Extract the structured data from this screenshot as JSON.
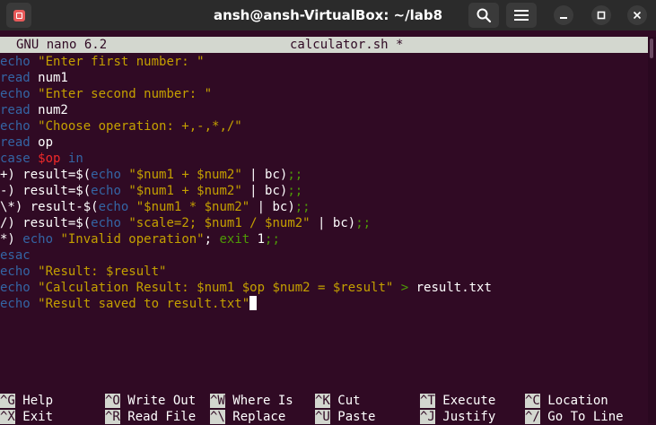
{
  "window": {
    "title": "ansh@ansh-VirtualBox: ~/lab8",
    "new_tab_icon": "new-tab-icon",
    "search_icon": "search-icon",
    "menu_icon": "hamburger-menu-icon",
    "minimize_icon": "minimize-icon",
    "maximize_icon": "maximize-icon",
    "close_icon": "close-icon"
  },
  "nano": {
    "version": "GNU nano 6.2",
    "filename": "calculator.sh *"
  },
  "colors": {
    "background": "#300a24",
    "keyword": "#3465a4",
    "string": "#c4a000",
    "variable": "#ef2929",
    "operator": "#4e9a06",
    "header": "#d3d7cf"
  },
  "code": {
    "line1": {
      "a": "echo",
      "b": " ",
      "c": "\"Enter first number: \""
    },
    "line2": {
      "a": "read",
      "b": " num1"
    },
    "line3": {
      "a": "echo",
      "b": " ",
      "c": "\"Enter second number: \""
    },
    "line4": {
      "a": "read",
      "b": " num2"
    },
    "line5": {
      "a": "echo",
      "b": " ",
      "c": "\"Choose operation: +,-,*,/\""
    },
    "line6": {
      "a": "read",
      "b": " op"
    },
    "line7": {
      "a": "case",
      "b": " ",
      "c": "$op",
      "d": " ",
      "e": "in"
    },
    "line8": {
      "a": "+) result=$(",
      "b": "echo",
      "c": " ",
      "d": "\"$num1 + $num2\"",
      "e": " | bc)",
      "f": ";;"
    },
    "line9": {
      "a": "-) result=$(",
      "b": "echo",
      "c": " ",
      "d": "\"$num1 + $num2\"",
      "e": " | bc)",
      "f": ";;"
    },
    "line10": {
      "a": "\\*) result-$(",
      "b": "echo",
      "c": " ",
      "d": "\"$num1 * $num2\"",
      "e": " | bc)",
      "f": ";;"
    },
    "line11": {
      "a": "/) result=$(",
      "b": "echo",
      "c": " ",
      "d": "\"scale=2; $num1 / $num2\"",
      "e": " | bc)",
      "f": ";;"
    },
    "line12": {
      "a": "*) ",
      "b": "echo",
      "c": " ",
      "d": "\"Invalid operation\"",
      "e": "; ",
      "f": "exit",
      "g": " 1",
      "h": ";;"
    },
    "line13": {
      "a": "esac"
    },
    "line14": {
      "a": "echo",
      "b": " ",
      "c": "\"Result: $result\""
    },
    "line15": {
      "a": "echo",
      "b": " ",
      "c": "\"Calculation Result: $num1 $op $num2 = $result\"",
      "d": " ",
      "e": ">",
      "f": " result.txt"
    },
    "line16": {
      "a": "echo",
      "b": " ",
      "c": "\"Result saved to result.txt\""
    }
  },
  "shortcuts": {
    "row1": [
      {
        "key": "^G",
        "label": " Help"
      },
      {
        "key": "^O",
        "label": " Write Out"
      },
      {
        "key": "^W",
        "label": " Where Is"
      },
      {
        "key": "^K",
        "label": " Cut"
      },
      {
        "key": "^T",
        "label": " Execute"
      },
      {
        "key": "^C",
        "label": " Location"
      }
    ],
    "row2": [
      {
        "key": "^X",
        "label": " Exit"
      },
      {
        "key": "^R",
        "label": " Read File"
      },
      {
        "key": "^\\",
        "label": " Replace"
      },
      {
        "key": "^U",
        "label": " Paste"
      },
      {
        "key": "^J",
        "label": " Justify"
      },
      {
        "key": "^/",
        "label": " Go To Line"
      }
    ]
  }
}
